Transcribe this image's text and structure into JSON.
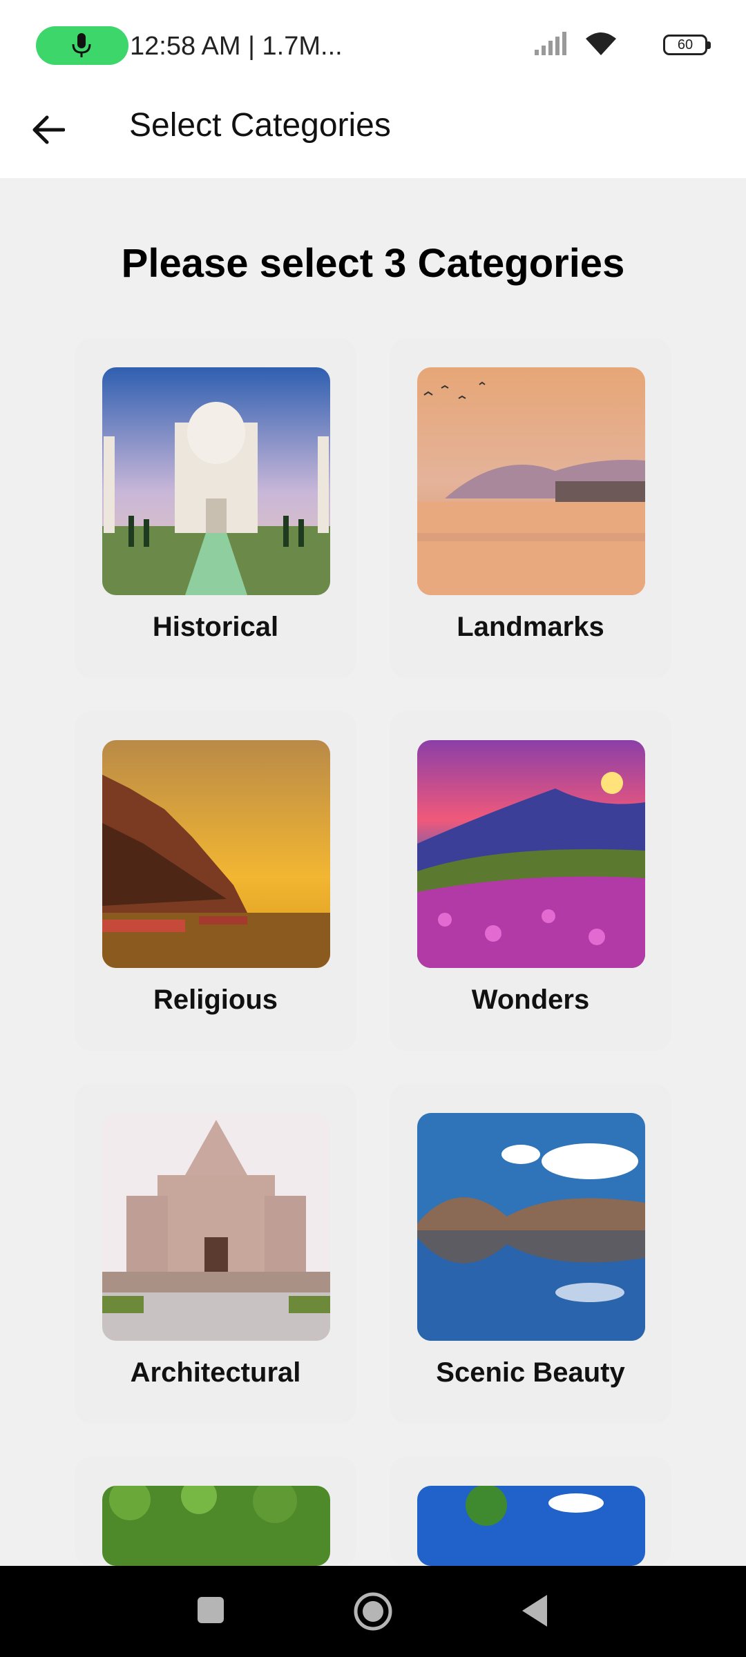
{
  "status_bar": {
    "text": "12:58 AM | 1.7M...",
    "battery": "60"
  },
  "app_bar": {
    "title": "Select Categories"
  },
  "heading": "Please select 3 Categories",
  "categories": [
    {
      "label": "Historical"
    },
    {
      "label": "Landmarks"
    },
    {
      "label": "Religious"
    },
    {
      "label": "Wonders"
    },
    {
      "label": "Architectural"
    },
    {
      "label": "Scenic Beauty"
    }
  ],
  "colors": {
    "accent": "#3dd66b",
    "background": "#f0f0f0",
    "card": "#eeeeee"
  }
}
